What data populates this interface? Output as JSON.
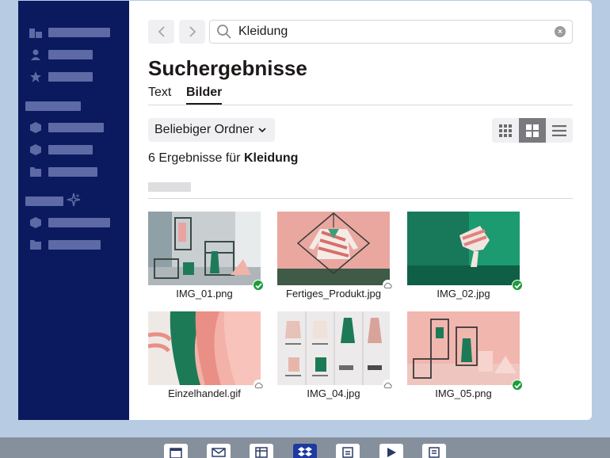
{
  "search": {
    "value": "Kleidung"
  },
  "page": {
    "title": "Suchergebnisse"
  },
  "tabs": [
    {
      "label": "Text"
    },
    {
      "label": "Bilder"
    }
  ],
  "filters": {
    "folder_label": "Beliebiger Ordner"
  },
  "results": {
    "count_prefix": "6 Ergebnisse für",
    "query": "Kleidung"
  },
  "view_modes": [
    "grid-small-icon",
    "grid-large-icon",
    "list-icon"
  ],
  "files": [
    {
      "name": "IMG_01.png",
      "status": "synced"
    },
    {
      "name": "Fertiges_Produkt.jpg",
      "status": "cloud"
    },
    {
      "name": "IMG_02.jpg",
      "status": "synced"
    },
    {
      "name": "Einzelhandel.gif",
      "status": "cloud"
    },
    {
      "name": "IMG_04.jpg",
      "status": "cloud"
    },
    {
      "name": "IMG_05.png",
      "status": "synced"
    }
  ],
  "colors": {
    "sidebar": "#0b1a5e",
    "sidebar_placeholder": "#5d6aa5",
    "synced": "#1d9c3a",
    "background": "#b7cbe3"
  },
  "dock": [
    "calendar-icon",
    "mail-icon",
    "table-icon",
    "dropbox-icon",
    "document-icon",
    "play-icon",
    "notes-icon"
  ]
}
